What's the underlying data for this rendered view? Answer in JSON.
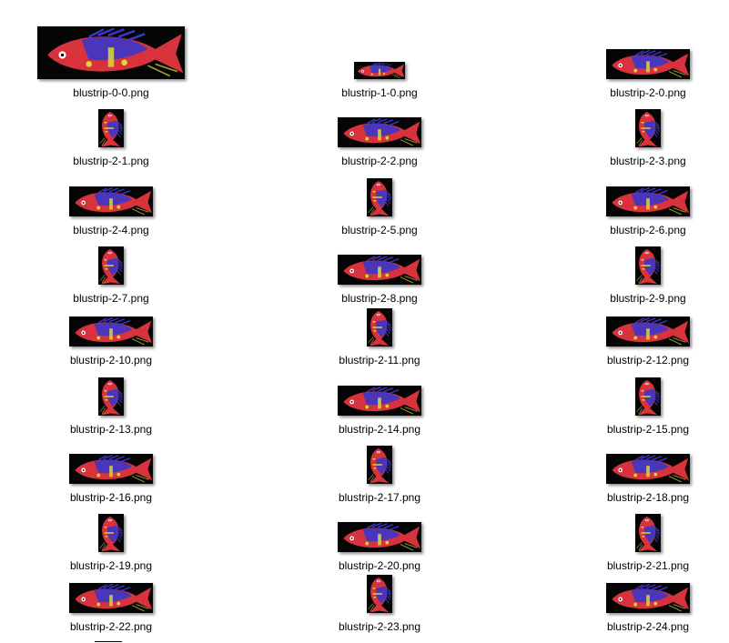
{
  "colors": {
    "background": "#ffffff",
    "thumb_background": "#050505",
    "fish_body": "#d8323c",
    "fish_stripe": "#3a36c8",
    "fish_spots": "#d8d83a",
    "fish_fins": "#9aa030"
  },
  "files": [
    {
      "name": "blustrip-0-0.png",
      "shape": "wide"
    },
    {
      "name": "blustrip-1-0.png",
      "shape": "small"
    },
    {
      "name": "blustrip-2-0.png",
      "shape": "wide"
    },
    {
      "name": "blustrip-2-1.png",
      "shape": "tall"
    },
    {
      "name": "blustrip-2-2.png",
      "shape": "wide"
    },
    {
      "name": "blustrip-2-3.png",
      "shape": "tall"
    },
    {
      "name": "blustrip-2-4.png",
      "shape": "wide"
    },
    {
      "name": "blustrip-2-5.png",
      "shape": "tall"
    },
    {
      "name": "blustrip-2-6.png",
      "shape": "wide"
    },
    {
      "name": "blustrip-2-7.png",
      "shape": "tall"
    },
    {
      "name": "blustrip-2-8.png",
      "shape": "wide"
    },
    {
      "name": "blustrip-2-9.png",
      "shape": "tall"
    },
    {
      "name": "blustrip-2-10.png",
      "shape": "wide"
    },
    {
      "name": "blustrip-2-11.png",
      "shape": "tall"
    },
    {
      "name": "blustrip-2-12.png",
      "shape": "wide"
    },
    {
      "name": "blustrip-2-13.png",
      "shape": "tall"
    },
    {
      "name": "blustrip-2-14.png",
      "shape": "wide"
    },
    {
      "name": "blustrip-2-15.png",
      "shape": "tall"
    },
    {
      "name": "blustrip-2-16.png",
      "shape": "wide"
    },
    {
      "name": "blustrip-2-17.png",
      "shape": "tall"
    },
    {
      "name": "blustrip-2-18.png",
      "shape": "wide"
    },
    {
      "name": "blustrip-2-19.png",
      "shape": "tall"
    },
    {
      "name": "blustrip-2-20.png",
      "shape": "wide"
    },
    {
      "name": "blustrip-2-21.png",
      "shape": "tall"
    },
    {
      "name": "blustrip-2-22.png",
      "shape": "wide"
    },
    {
      "name": "blustrip-2-23.png",
      "shape": "tall"
    },
    {
      "name": "blustrip-2-24.png",
      "shape": "wide"
    }
  ]
}
